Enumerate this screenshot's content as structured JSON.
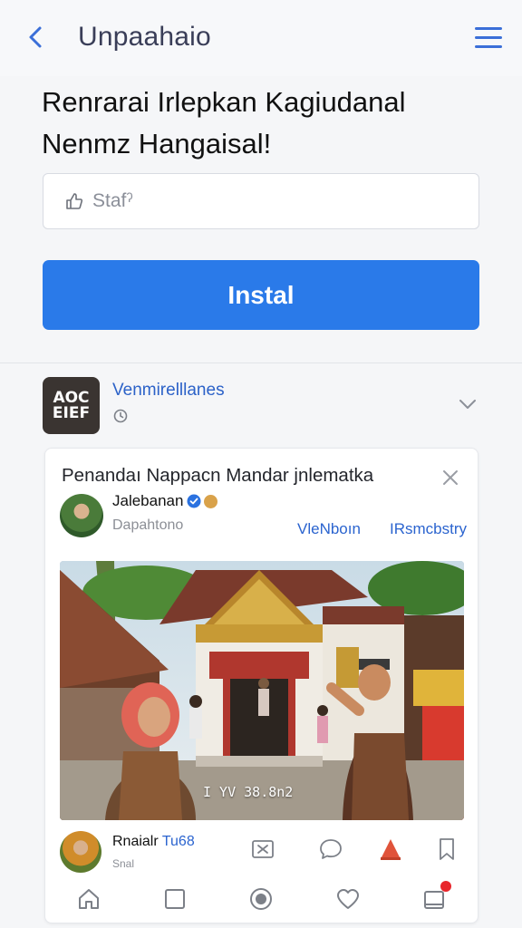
{
  "topbar": {
    "title": "Unpaahaio",
    "back_icon": "chevron-left-icon",
    "menu_icon": "hamburger-menu-icon"
  },
  "headline": {
    "line1": "Renrarai Irlepkan Kagiudanal",
    "line2": "Nenmz Hangaisal!"
  },
  "input": {
    "placeholder": "Stafˀ",
    "value": ""
  },
  "install": {
    "label": "Instal"
  },
  "channel": {
    "logo_line1": "AO⁠C",
    "logo_line2": "EIEF",
    "name": "Venmirelllanes"
  },
  "card": {
    "title": "Penandaı Nappacn Mandar jnlematka",
    "author": "Jalebanan",
    "handle": "Dapahtono",
    "link_view": "VleNboın",
    "link_registry": "IRsmcbstry",
    "photo_caption": "I YV 38.8n2",
    "footer_name_a": "Rnaialr ",
    "footer_name_b": "Tu68",
    "footer_sub": "Snal"
  },
  "colors": {
    "accent": "#2a7ae9",
    "link": "#2b64cf",
    "badge": "#e8262c"
  },
  "nav": {
    "items": [
      "home-icon",
      "square-icon",
      "record-icon",
      "heart-icon",
      "notification-icon"
    ]
  }
}
